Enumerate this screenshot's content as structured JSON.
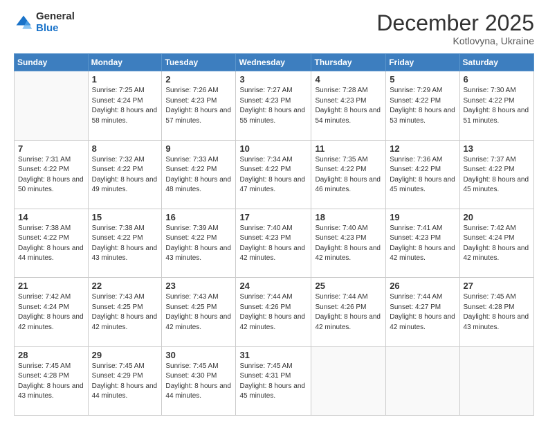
{
  "logo": {
    "general": "General",
    "blue": "Blue"
  },
  "title": "December 2025",
  "subtitle": "Kotlovyna, Ukraine",
  "days_header": [
    "Sunday",
    "Monday",
    "Tuesday",
    "Wednesday",
    "Thursday",
    "Friday",
    "Saturday"
  ],
  "weeks": [
    [
      {
        "day": "",
        "sunrise": "",
        "sunset": "",
        "daylight": ""
      },
      {
        "day": "1",
        "sunrise": "Sunrise: 7:25 AM",
        "sunset": "Sunset: 4:24 PM",
        "daylight": "Daylight: 8 hours and 58 minutes."
      },
      {
        "day": "2",
        "sunrise": "Sunrise: 7:26 AM",
        "sunset": "Sunset: 4:23 PM",
        "daylight": "Daylight: 8 hours and 57 minutes."
      },
      {
        "day": "3",
        "sunrise": "Sunrise: 7:27 AM",
        "sunset": "Sunset: 4:23 PM",
        "daylight": "Daylight: 8 hours and 55 minutes."
      },
      {
        "day": "4",
        "sunrise": "Sunrise: 7:28 AM",
        "sunset": "Sunset: 4:23 PM",
        "daylight": "Daylight: 8 hours and 54 minutes."
      },
      {
        "day": "5",
        "sunrise": "Sunrise: 7:29 AM",
        "sunset": "Sunset: 4:22 PM",
        "daylight": "Daylight: 8 hours and 53 minutes."
      },
      {
        "day": "6",
        "sunrise": "Sunrise: 7:30 AM",
        "sunset": "Sunset: 4:22 PM",
        "daylight": "Daylight: 8 hours and 51 minutes."
      }
    ],
    [
      {
        "day": "7",
        "sunrise": "Sunrise: 7:31 AM",
        "sunset": "Sunset: 4:22 PM",
        "daylight": "Daylight: 8 hours and 50 minutes."
      },
      {
        "day": "8",
        "sunrise": "Sunrise: 7:32 AM",
        "sunset": "Sunset: 4:22 PM",
        "daylight": "Daylight: 8 hours and 49 minutes."
      },
      {
        "day": "9",
        "sunrise": "Sunrise: 7:33 AM",
        "sunset": "Sunset: 4:22 PM",
        "daylight": "Daylight: 8 hours and 48 minutes."
      },
      {
        "day": "10",
        "sunrise": "Sunrise: 7:34 AM",
        "sunset": "Sunset: 4:22 PM",
        "daylight": "Daylight: 8 hours and 47 minutes."
      },
      {
        "day": "11",
        "sunrise": "Sunrise: 7:35 AM",
        "sunset": "Sunset: 4:22 PM",
        "daylight": "Daylight: 8 hours and 46 minutes."
      },
      {
        "day": "12",
        "sunrise": "Sunrise: 7:36 AM",
        "sunset": "Sunset: 4:22 PM",
        "daylight": "Daylight: 8 hours and 45 minutes."
      },
      {
        "day": "13",
        "sunrise": "Sunrise: 7:37 AM",
        "sunset": "Sunset: 4:22 PM",
        "daylight": "Daylight: 8 hours and 45 minutes."
      }
    ],
    [
      {
        "day": "14",
        "sunrise": "Sunrise: 7:38 AM",
        "sunset": "Sunset: 4:22 PM",
        "daylight": "Daylight: 8 hours and 44 minutes."
      },
      {
        "day": "15",
        "sunrise": "Sunrise: 7:38 AM",
        "sunset": "Sunset: 4:22 PM",
        "daylight": "Daylight: 8 hours and 43 minutes."
      },
      {
        "day": "16",
        "sunrise": "Sunrise: 7:39 AM",
        "sunset": "Sunset: 4:22 PM",
        "daylight": "Daylight: 8 hours and 43 minutes."
      },
      {
        "day": "17",
        "sunrise": "Sunrise: 7:40 AM",
        "sunset": "Sunset: 4:23 PM",
        "daylight": "Daylight: 8 hours and 42 minutes."
      },
      {
        "day": "18",
        "sunrise": "Sunrise: 7:40 AM",
        "sunset": "Sunset: 4:23 PM",
        "daylight": "Daylight: 8 hours and 42 minutes."
      },
      {
        "day": "19",
        "sunrise": "Sunrise: 7:41 AM",
        "sunset": "Sunset: 4:23 PM",
        "daylight": "Daylight: 8 hours and 42 minutes."
      },
      {
        "day": "20",
        "sunrise": "Sunrise: 7:42 AM",
        "sunset": "Sunset: 4:24 PM",
        "daylight": "Daylight: 8 hours and 42 minutes."
      }
    ],
    [
      {
        "day": "21",
        "sunrise": "Sunrise: 7:42 AM",
        "sunset": "Sunset: 4:24 PM",
        "daylight": "Daylight: 8 hours and 42 minutes."
      },
      {
        "day": "22",
        "sunrise": "Sunrise: 7:43 AM",
        "sunset": "Sunset: 4:25 PM",
        "daylight": "Daylight: 8 hours and 42 minutes."
      },
      {
        "day": "23",
        "sunrise": "Sunrise: 7:43 AM",
        "sunset": "Sunset: 4:25 PM",
        "daylight": "Daylight: 8 hours and 42 minutes."
      },
      {
        "day": "24",
        "sunrise": "Sunrise: 7:44 AM",
        "sunset": "Sunset: 4:26 PM",
        "daylight": "Daylight: 8 hours and 42 minutes."
      },
      {
        "day": "25",
        "sunrise": "Sunrise: 7:44 AM",
        "sunset": "Sunset: 4:26 PM",
        "daylight": "Daylight: 8 hours and 42 minutes."
      },
      {
        "day": "26",
        "sunrise": "Sunrise: 7:44 AM",
        "sunset": "Sunset: 4:27 PM",
        "daylight": "Daylight: 8 hours and 42 minutes."
      },
      {
        "day": "27",
        "sunrise": "Sunrise: 7:45 AM",
        "sunset": "Sunset: 4:28 PM",
        "daylight": "Daylight: 8 hours and 43 minutes."
      }
    ],
    [
      {
        "day": "28",
        "sunrise": "Sunrise: 7:45 AM",
        "sunset": "Sunset: 4:28 PM",
        "daylight": "Daylight: 8 hours and 43 minutes."
      },
      {
        "day": "29",
        "sunrise": "Sunrise: 7:45 AM",
        "sunset": "Sunset: 4:29 PM",
        "daylight": "Daylight: 8 hours and 44 minutes."
      },
      {
        "day": "30",
        "sunrise": "Sunrise: 7:45 AM",
        "sunset": "Sunset: 4:30 PM",
        "daylight": "Daylight: 8 hours and 44 minutes."
      },
      {
        "day": "31",
        "sunrise": "Sunrise: 7:45 AM",
        "sunset": "Sunset: 4:31 PM",
        "daylight": "Daylight: 8 hours and 45 minutes."
      },
      {
        "day": "",
        "sunrise": "",
        "sunset": "",
        "daylight": ""
      },
      {
        "day": "",
        "sunrise": "",
        "sunset": "",
        "daylight": ""
      },
      {
        "day": "",
        "sunrise": "",
        "sunset": "",
        "daylight": ""
      }
    ]
  ]
}
